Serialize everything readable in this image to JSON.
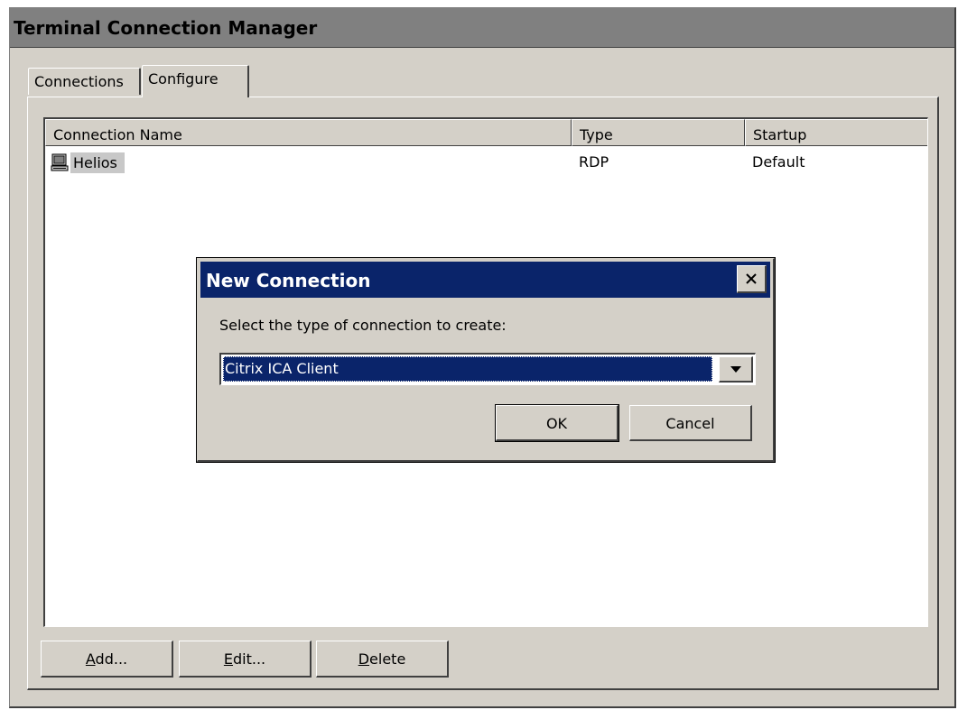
{
  "window": {
    "title": "Terminal Connection Manager"
  },
  "tabs": [
    {
      "label": "Connections"
    },
    {
      "label": "Configure"
    }
  ],
  "list": {
    "columns": [
      "Connection Name",
      "Type",
      "Startup"
    ],
    "rows": [
      {
        "name": "Helios",
        "type": "RDP",
        "startup": "Default",
        "icon": "computer-icon"
      }
    ]
  },
  "buttons": {
    "add": {
      "acc": "A",
      "rest": "dd..."
    },
    "edit": {
      "acc": "E",
      "rest": "dit..."
    },
    "delete": {
      "acc": "D",
      "rest": "elete"
    }
  },
  "dialog": {
    "title": "New Connection",
    "prompt": "Select the type of connection to create:",
    "selected": "Citrix ICA Client",
    "ok": "OK",
    "cancel": "Cancel",
    "close_icon": "close-icon"
  },
  "colors": {
    "face": "#d4d0c8",
    "dialog_title": "#0a246a",
    "main_title": "#808080",
    "selection": "#0a246a"
  }
}
